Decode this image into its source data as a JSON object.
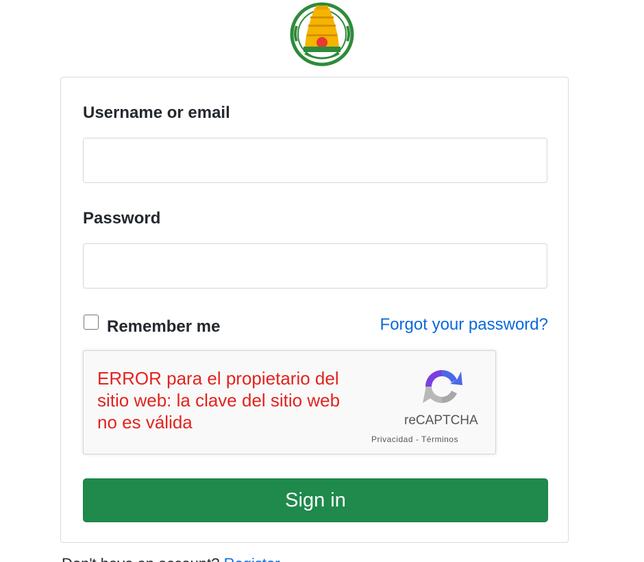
{
  "logo": {
    "name": "tamil-nadu-emblem",
    "colors": {
      "ring": "#2e8b3a",
      "tower": "#f4b400",
      "accent": "#e53935"
    }
  },
  "form": {
    "username_label": "Username or email",
    "username_value": "",
    "password_label": "Password",
    "password_value": "",
    "remember_label": "Remember me",
    "remember_checked": false,
    "forgot_link": "Forgot your password?",
    "signin_label": "Sign in"
  },
  "recaptcha": {
    "error_text": "ERROR para el propietario del sitio web: la clave del sitio web no es válida",
    "brand": "reCAPTCHA",
    "links": "Privacidad - Términos",
    "icon": "recaptcha-icon"
  },
  "footer": {
    "prompt": "Don't have an account?",
    "register_link": "Register"
  },
  "colors": {
    "primary_button": "#1f8a4c",
    "link": "#0969da",
    "error": "#e3231d"
  }
}
